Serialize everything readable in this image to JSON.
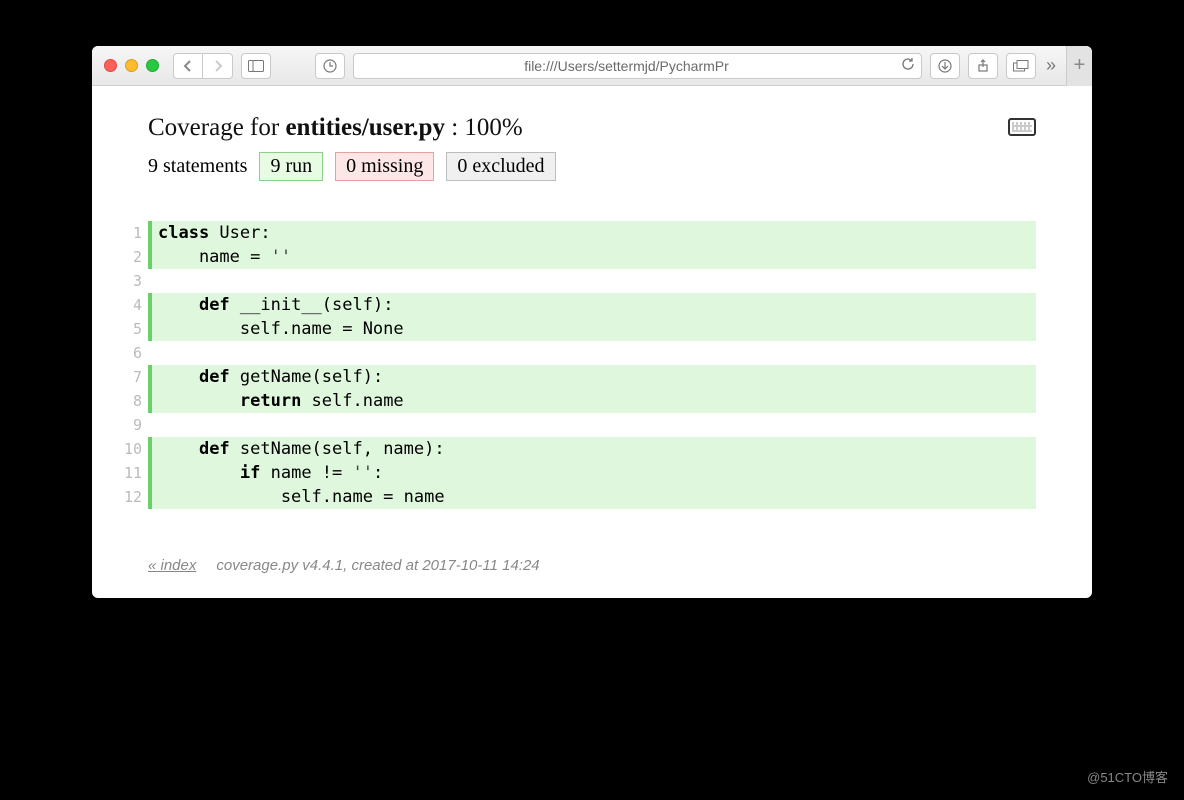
{
  "browser": {
    "address": "file:///Users/settermjd/PycharmPr"
  },
  "header": {
    "title_prefix": "Coverage for ",
    "title_file": "entities/user.py",
    "title_suffix": " : 100%"
  },
  "stats": {
    "statements": "9 statements",
    "run": "9 run",
    "missing": "0 missing",
    "excluded": "0 excluded"
  },
  "code": [
    {
      "n": "1",
      "run": true,
      "tokens": [
        {
          "t": "class ",
          "k": true
        },
        {
          "t": "User:"
        }
      ]
    },
    {
      "n": "2",
      "run": true,
      "tokens": [
        {
          "t": "    name = "
        },
        {
          "t": "''",
          "s": true
        }
      ]
    },
    {
      "n": "3",
      "run": false,
      "tokens": [
        {
          "t": ""
        }
      ]
    },
    {
      "n": "4",
      "run": true,
      "tokens": [
        {
          "t": "    "
        },
        {
          "t": "def ",
          "k": true
        },
        {
          "t": "__init__(self):"
        }
      ]
    },
    {
      "n": "5",
      "run": true,
      "tokens": [
        {
          "t": "        self.name = None"
        }
      ]
    },
    {
      "n": "6",
      "run": false,
      "tokens": [
        {
          "t": ""
        }
      ]
    },
    {
      "n": "7",
      "run": true,
      "tokens": [
        {
          "t": "    "
        },
        {
          "t": "def ",
          "k": true
        },
        {
          "t": "getName(self):"
        }
      ]
    },
    {
      "n": "8",
      "run": true,
      "tokens": [
        {
          "t": "        "
        },
        {
          "t": "return ",
          "k": true
        },
        {
          "t": "self.name"
        }
      ]
    },
    {
      "n": "9",
      "run": false,
      "tokens": [
        {
          "t": ""
        }
      ]
    },
    {
      "n": "10",
      "run": true,
      "tokens": [
        {
          "t": "    "
        },
        {
          "t": "def ",
          "k": true
        },
        {
          "t": "setName(self, name):"
        }
      ]
    },
    {
      "n": "11",
      "run": true,
      "tokens": [
        {
          "t": "        "
        },
        {
          "t": "if ",
          "k": true
        },
        {
          "t": "name != "
        },
        {
          "t": "''",
          "s": true
        },
        {
          "t": ":"
        }
      ]
    },
    {
      "n": "12",
      "run": true,
      "tokens": [
        {
          "t": "            self.name = name"
        }
      ]
    }
  ],
  "footer": {
    "index": "« index",
    "meta": "coverage.py v4.4.1, created at 2017-10-11 14:24"
  },
  "watermark": "@51CTO博客"
}
